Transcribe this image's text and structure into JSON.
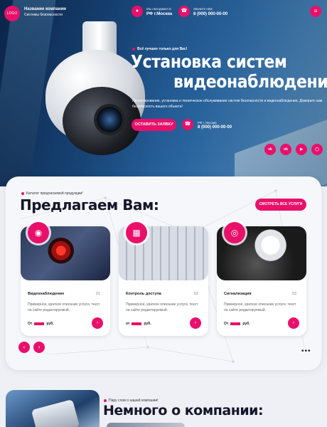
{
  "header": {
    "logo": "LOGO",
    "company_name": "Название компании",
    "company_sub": "Системы безопасности",
    "address_label": "Мы находимся в:",
    "address_value": "РФ г.Москва",
    "phone_label": "Звоните нам:",
    "phone_value": "8 (000) 000-00-00"
  },
  "hero": {
    "tagline": "Всё лучшее только для Вас!",
    "title_line1": "Установка систем",
    "title_line2": "видеонаблюдения",
    "description": "Проектирование, установка и техническое обслуживание систем безопасности и видеонаблюдения. Доверьте нам безопасность вашего объекта!",
    "cta_label": "ОСТАВИТЬ ЗАЯВКУ",
    "phone_label": "РФ г. Москва",
    "phone_value": "8 (000) 000-00-00",
    "socials": [
      "vk",
      "ok",
      "yt",
      "ig"
    ]
  },
  "catalog": {
    "label": "Каталог предлагаемой продукции!",
    "title": "Предлагаем Вам:",
    "all_services_label": "СМОТРЕТЬ ВСЕ УСЛУГИ",
    "cards": [
      {
        "name": "Видеонаблюдение",
        "num": "01",
        "desc": "Примерное, краткое описание услуги, текст на сайте редактируемый.",
        "price_prefix": "От",
        "price_suffix": "руб.",
        "icon": "cctv-icon"
      },
      {
        "name": "Контроль доступа",
        "num": "02",
        "desc": "Примерное, краткое описание услуги, текст на сайте редактируемый.",
        "price_prefix": "от",
        "price_suffix": "руб.",
        "icon": "turnstile-icon"
      },
      {
        "name": "Сигнализация",
        "num": "03",
        "desc": "Примерное, краткое описание услуги, текст на сайте редактируемый.",
        "price_prefix": "От",
        "price_suffix": "руб.",
        "icon": "smoke-detector-icon"
      }
    ]
  },
  "about": {
    "label": "Пару слов о нашей компании!",
    "title": "Немного о компании:"
  },
  "colors": {
    "accent": "#e8106a",
    "hero_dark": "#0d2a55",
    "panel": "#f6f7fa"
  }
}
